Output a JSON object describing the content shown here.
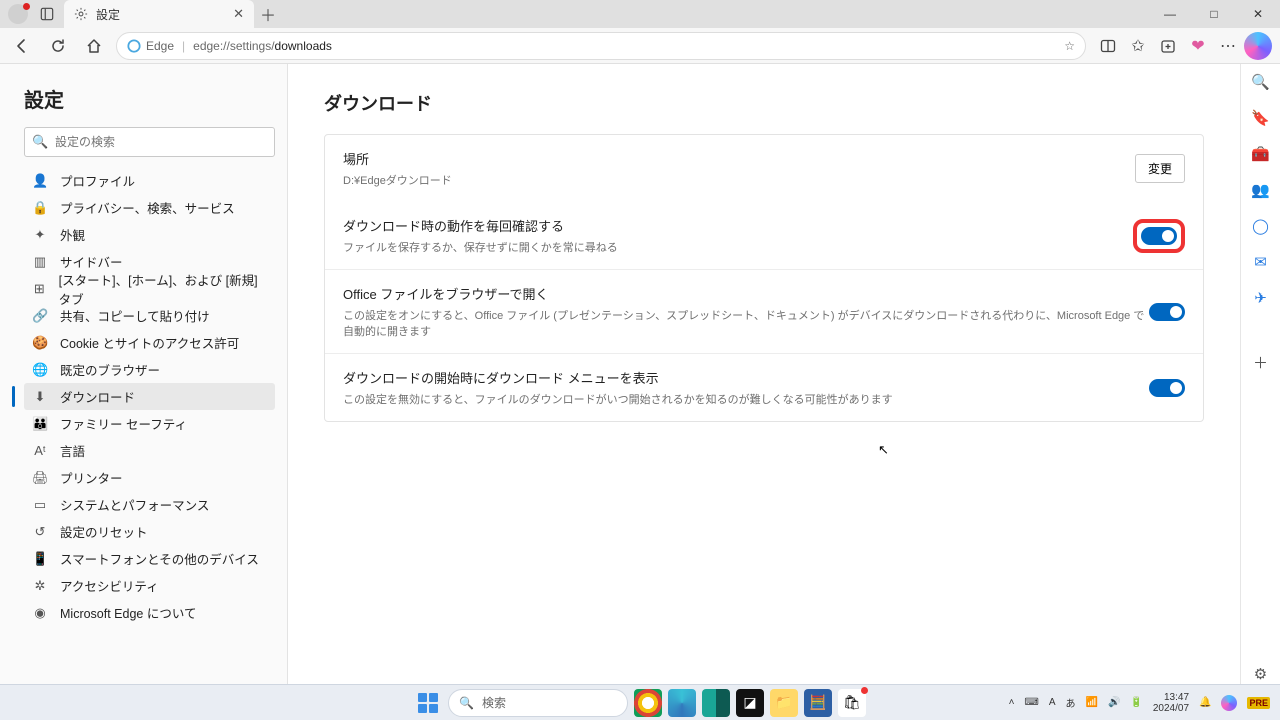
{
  "window": {
    "tab_title": "設定",
    "minimize": "—",
    "maximize": "□",
    "close": "✕"
  },
  "toolbar": {
    "edge_label": "Edge",
    "url_prefix": "edge://settings/",
    "url_suffix": "downloads"
  },
  "sidebar": {
    "title": "設定",
    "search_placeholder": "設定の検索",
    "items": [
      {
        "icon": "👤",
        "label": "プロファイル"
      },
      {
        "icon": "🔒",
        "label": "プライバシー、検索、サービス"
      },
      {
        "icon": "✦",
        "label": "外観"
      },
      {
        "icon": "▥",
        "label": "サイドバー"
      },
      {
        "icon": "⊞",
        "label": "[スタート]、[ホーム]、および [新規] タブ"
      },
      {
        "icon": "🔗",
        "label": "共有、コピーして貼り付け"
      },
      {
        "icon": "🍪",
        "label": "Cookie とサイトのアクセス許可"
      },
      {
        "icon": "🌐",
        "label": "既定のブラウザー"
      },
      {
        "icon": "⬇",
        "label": "ダウンロード",
        "active": true
      },
      {
        "icon": "👪",
        "label": "ファミリー セーフティ"
      },
      {
        "icon": "Aᵗ",
        "label": "言語"
      },
      {
        "icon": "🖨",
        "label": "プリンター"
      },
      {
        "icon": "▭",
        "label": "システムとパフォーマンス"
      },
      {
        "icon": "↺",
        "label": "設定のリセット"
      },
      {
        "icon": "📱",
        "label": "スマートフォンとその他のデバイス"
      },
      {
        "icon": "✲",
        "label": "アクセシビリティ"
      },
      {
        "icon": "◉",
        "label": "Microsoft Edge について"
      }
    ]
  },
  "content": {
    "heading": "ダウンロード",
    "location": {
      "title": "場所",
      "path": "D:¥Edgeダウンロード",
      "change": "変更"
    },
    "rows": [
      {
        "title": "ダウンロード時の動作を毎回確認する",
        "sub": "ファイルを保存するか、保存せずに開くかを常に尋ねる",
        "on": true,
        "highlight": true
      },
      {
        "title": "Office ファイルをブラウザーで開く",
        "sub": "この設定をオンにすると、Office ファイル (プレゼンテーション、スプレッドシート、ドキュメント) がデバイスにダウンロードされる代わりに、Microsoft Edge で自動的に開きます",
        "on": true
      },
      {
        "title": "ダウンロードの開始時にダウンロード メニューを表示",
        "sub": "この設定を無効にすると、ファイルのダウンロードがいつ開始されるかを知るのが難しくなる可能性があります",
        "on": true
      }
    ]
  },
  "taskbar": {
    "search_placeholder": "検索",
    "clock_time": "13:47",
    "clock_date": "2024/07"
  }
}
